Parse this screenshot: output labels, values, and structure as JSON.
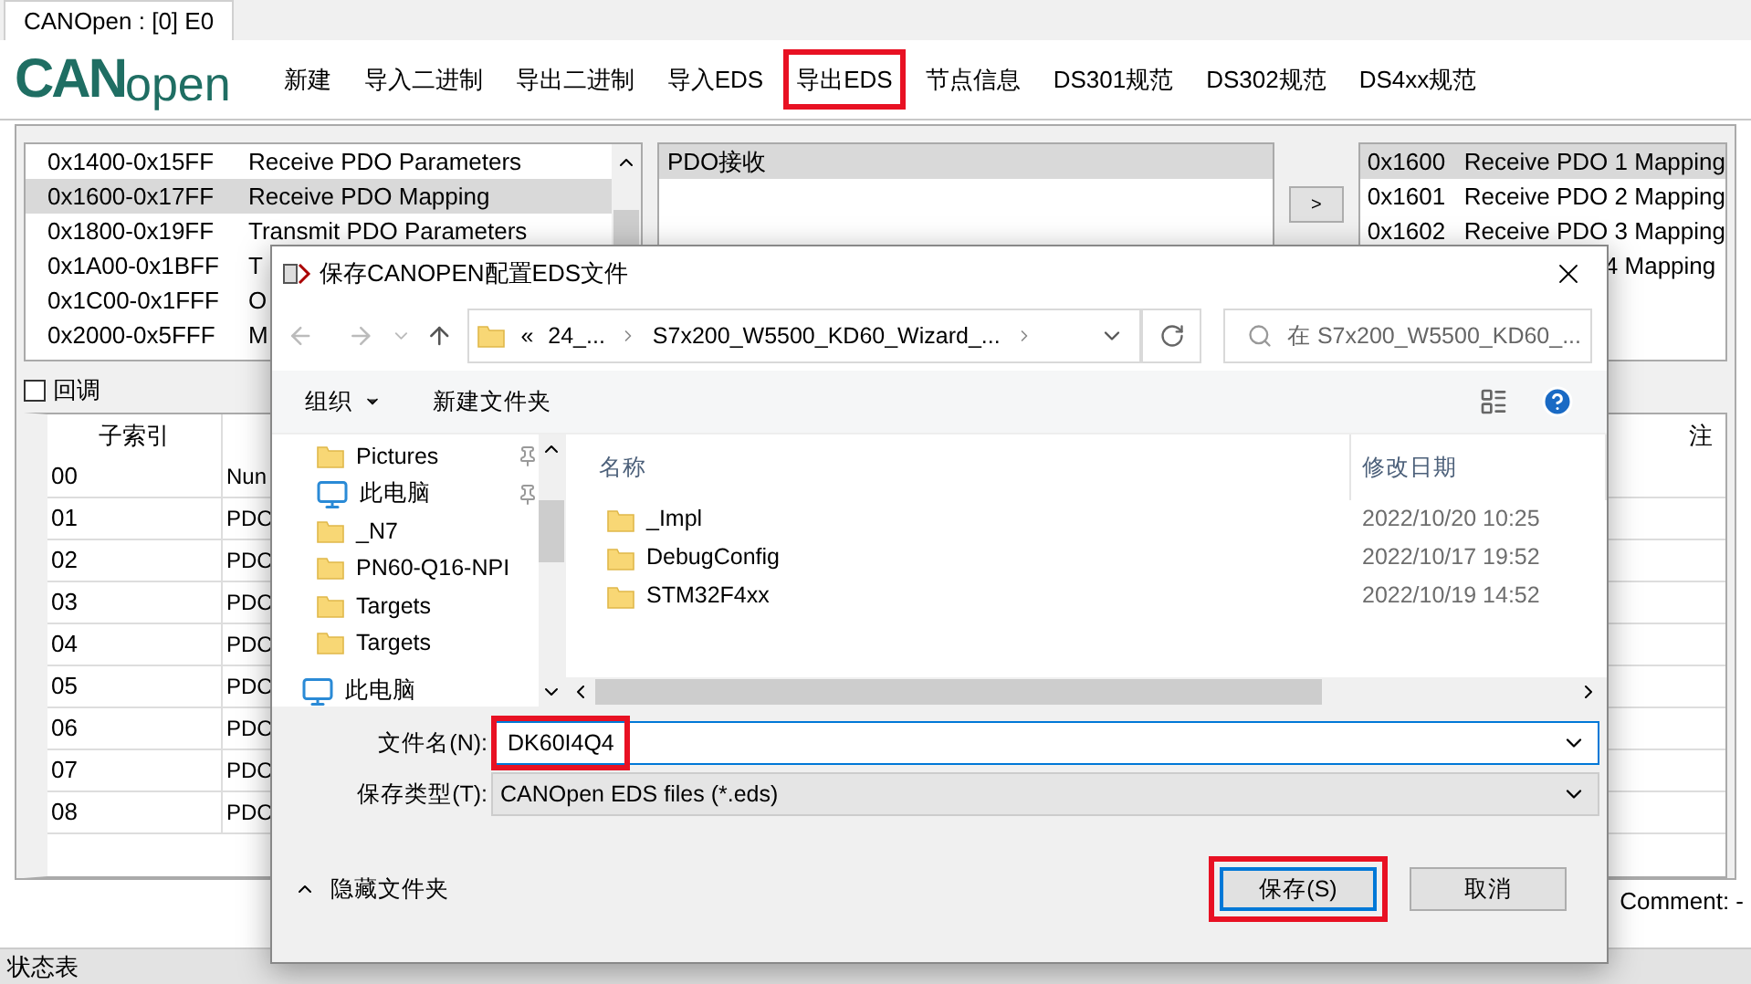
{
  "window": {
    "tab": "CANOpen : [0] E0"
  },
  "logo": {
    "bold": "CAN",
    "light": "open"
  },
  "toolbar": [
    {
      "label": "新建",
      "highlighted": false
    },
    {
      "label": "导入二进制",
      "highlighted": false
    },
    {
      "label": "导出二进制",
      "highlighted": false
    },
    {
      "label": "导入EDS",
      "highlighted": false
    },
    {
      "label": "导出EDS",
      "highlighted": true
    },
    {
      "label": "节点信息",
      "highlighted": false
    },
    {
      "label": "DS301规范",
      "highlighted": false
    },
    {
      "label": "DS302规范",
      "highlighted": false
    },
    {
      "label": "DS4xx规范",
      "highlighted": false
    }
  ],
  "range_list": [
    {
      "range": "0x1400-0x15FF",
      "name": "Receive PDO Parameters",
      "selected": false
    },
    {
      "range": "0x1600-0x17FF",
      "name": "Receive PDO Mapping",
      "selected": true
    },
    {
      "range": "0x1800-0x19FF",
      "name": "Transmit PDO Parameters",
      "selected": false
    },
    {
      "range": "0x1A00-0x1BFF",
      "name": "T",
      "selected": false
    },
    {
      "range": "0x1C00-0x1FFF",
      "name": "O",
      "selected": false
    },
    {
      "range": "0x2000-0x5FFF",
      "name": "M",
      "selected": false
    }
  ],
  "pdo_list": {
    "header": "PDO接收"
  },
  "move_button": ">",
  "mapping_list": [
    {
      "index": "0x1600",
      "name": "Receive PDO 1 Mapping",
      "selected": true
    },
    {
      "index": "0x1601",
      "name": "Receive PDO 2 Mapping",
      "selected": false
    },
    {
      "index": "0x1602",
      "name": "Receive PDO 3 Mapping",
      "selected": false
    },
    {
      "name": "4 Mapping",
      "selected": false
    }
  ],
  "callback": {
    "label": "回调",
    "checked": false
  },
  "table": {
    "columns": [
      "子索引",
      "注"
    ],
    "rows": [
      [
        "00",
        "Nun"
      ],
      [
        "01",
        "PDC"
      ],
      [
        "02",
        "PDC"
      ],
      [
        "03",
        "PDC"
      ],
      [
        "04",
        "PDC"
      ],
      [
        "05",
        "PDC"
      ],
      [
        "06",
        "PDC"
      ],
      [
        "07",
        "PDC"
      ],
      [
        "08",
        "PDC"
      ]
    ]
  },
  "comment": "Comment: -",
  "status_bar": {
    "label": "状态表"
  },
  "dialog": {
    "title": "保存CANOPEN配置EDS文件",
    "path": [
      "«",
      "24_...",
      "S7x200_W5500_KD60_Wizard_..."
    ],
    "search": {
      "placeholder": "在 S7x200_W5500_KD60_..."
    },
    "organize": "组织",
    "new_folder": "新建文件夹",
    "nav": [
      {
        "label": "Pictures",
        "kind": "folder",
        "pinned": true
      },
      {
        "label": "此电脑",
        "kind": "computer",
        "pinned": true
      },
      {
        "label": "_N7",
        "kind": "folder",
        "pinned": false
      },
      {
        "label": "PN60-Q16-NPI",
        "kind": "folder",
        "pinned": false
      },
      {
        "label": "Targets",
        "kind": "folder",
        "pinned": false
      },
      {
        "label": "Targets",
        "kind": "folder",
        "pinned": false
      },
      {
        "label": "此电脑",
        "kind": "computer-root",
        "pinned": false
      }
    ],
    "columns": [
      "名称",
      "修改日期"
    ],
    "files": [
      {
        "name": "_Impl",
        "date": "2022/10/20 10:25"
      },
      {
        "name": "DebugConfig",
        "date": "2022/10/17 19:52"
      },
      {
        "name": "STM32F4xx",
        "date": "2022/10/19 14:52"
      }
    ],
    "filename": {
      "label": "文件名(N):",
      "value": "DK60I4Q4",
      "highlighted": true
    },
    "filetype": {
      "label": "保存类型(T):",
      "value": "CANOpen EDS files (*.eds)"
    },
    "hide_folders": "隐藏文件夹",
    "buttons": [
      {
        "label": "保存(S)",
        "kind": "primary",
        "highlighted": true
      },
      {
        "label": "取消",
        "kind": "secondary",
        "highlighted": false
      }
    ]
  }
}
